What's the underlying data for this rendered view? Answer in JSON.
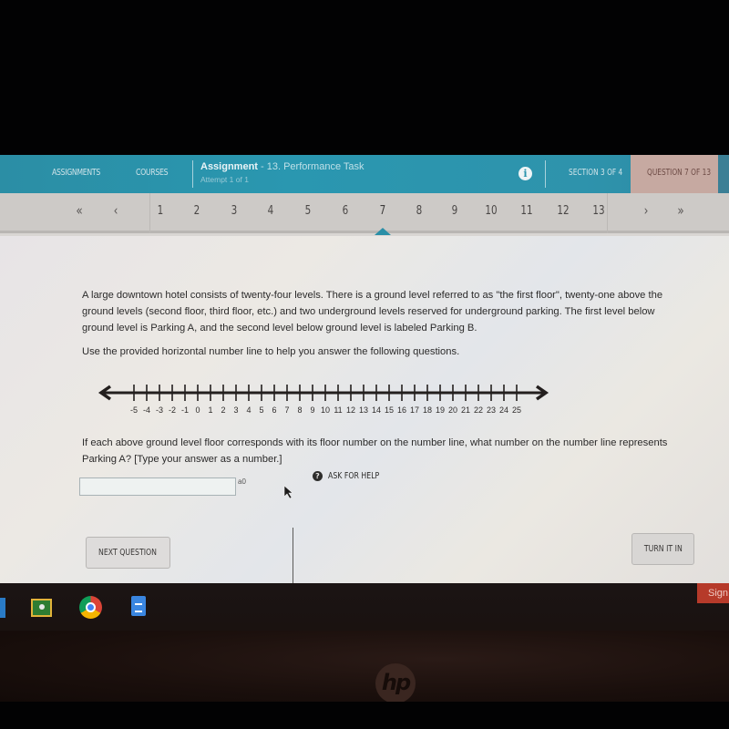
{
  "header": {
    "nav_assignments": "ASSIGNMENTS",
    "nav_courses": "COURSES",
    "assignment_label": "Assignment",
    "assignment_task": "- 13. Performance Task",
    "attempt": "Attempt 1 of 1",
    "info_icon": "info-icon",
    "section": "SECTION 3 OF 4",
    "question": "QUESTION 7 OF 13",
    "colors": {
      "bar": "#2a93ac",
      "question_box": "#c6a9a1",
      "current_marker": "#2a8fa7"
    }
  },
  "question_nav": {
    "first": "«",
    "prev": "‹",
    "next": "›",
    "last": "»",
    "items": [
      "1",
      "2",
      "3",
      "4",
      "5",
      "6",
      "7",
      "8",
      "9",
      "10",
      "11",
      "12",
      "13"
    ],
    "current": "7"
  },
  "content": {
    "paragraph1": "A large downtown hotel consists of twenty-four levels. There is a ground level referred to as \"the first floor\", twenty-one above the ground levels (second floor, third floor, etc.) and two underground levels reserved for underground parking. The first level below ground level is Parking A, and the second level below ground level is labeled Parking B.",
    "paragraph2": "Use the provided horizontal number line to help you answer the following questions.",
    "number_line": {
      "min": -5,
      "max": 25,
      "step": 1,
      "ticks": [
        "-5",
        "-4",
        "-3",
        "-2",
        "-1",
        "0",
        "1",
        "2",
        "3",
        "4",
        "5",
        "6",
        "7",
        "8",
        "9",
        "10",
        "11",
        "12",
        "13",
        "14",
        "15",
        "16",
        "17",
        "18",
        "19",
        "20",
        "21",
        "22",
        "23",
        "24",
        "25"
      ],
      "arrows": "both"
    },
    "question": "If each above ground level floor corresponds with its floor number on the number line, what number on the number line represents Parking A? [Type your answer as a number.]",
    "answer_value": "",
    "answer_placeholder": "",
    "char_count": "a0"
  },
  "footer": {
    "next_question": "NEXT QUESTION",
    "ask_for_help": "ASK FOR HELP",
    "help_icon": "?",
    "turn_it_in": "TURN IT IN"
  },
  "taskbar": {
    "apps": [
      "edge-app",
      "google-classroom",
      "chrome",
      "google-docs"
    ],
    "sign_button": "Sign"
  },
  "bezel": {
    "logo": "hp"
  }
}
